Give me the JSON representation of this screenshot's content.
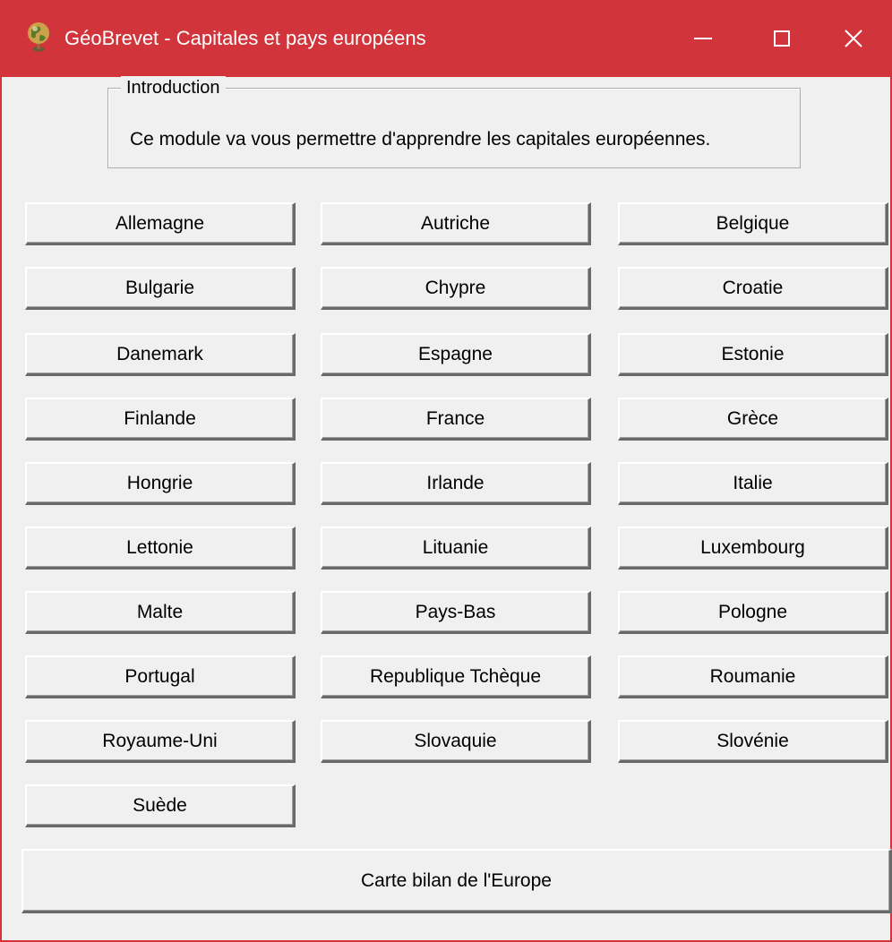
{
  "window": {
    "title": "GéoBrevet - Capitales et pays européens",
    "accent_color": "#d1343a",
    "app_icon": "globe-icon",
    "controls": {
      "minimize": "minimize-icon",
      "maximize": "maximize-icon",
      "close": "close-icon"
    }
  },
  "intro": {
    "legend": "Introduction",
    "text": "Ce module va vous permettre d'apprendre les capitales européennes."
  },
  "countries": [
    "Allemagne",
    "Autriche",
    "Belgique",
    "Bulgarie",
    "Chypre",
    "Croatie",
    "Danemark",
    "Espagne",
    "Estonie",
    "Finlande",
    "France",
    "Grèce",
    "Hongrie",
    "Irlande",
    "Italie",
    "Lettonie",
    "Lituanie",
    "Luxembourg",
    "Malte",
    "Pays-Bas",
    "Pologne",
    "Portugal",
    "Republique Tchèque",
    "Roumanie",
    "Royaume-Uni",
    "Slovaquie",
    "Slovénie",
    "Suède"
  ],
  "footer": {
    "map_button": "Carte bilan de l'Europe"
  }
}
